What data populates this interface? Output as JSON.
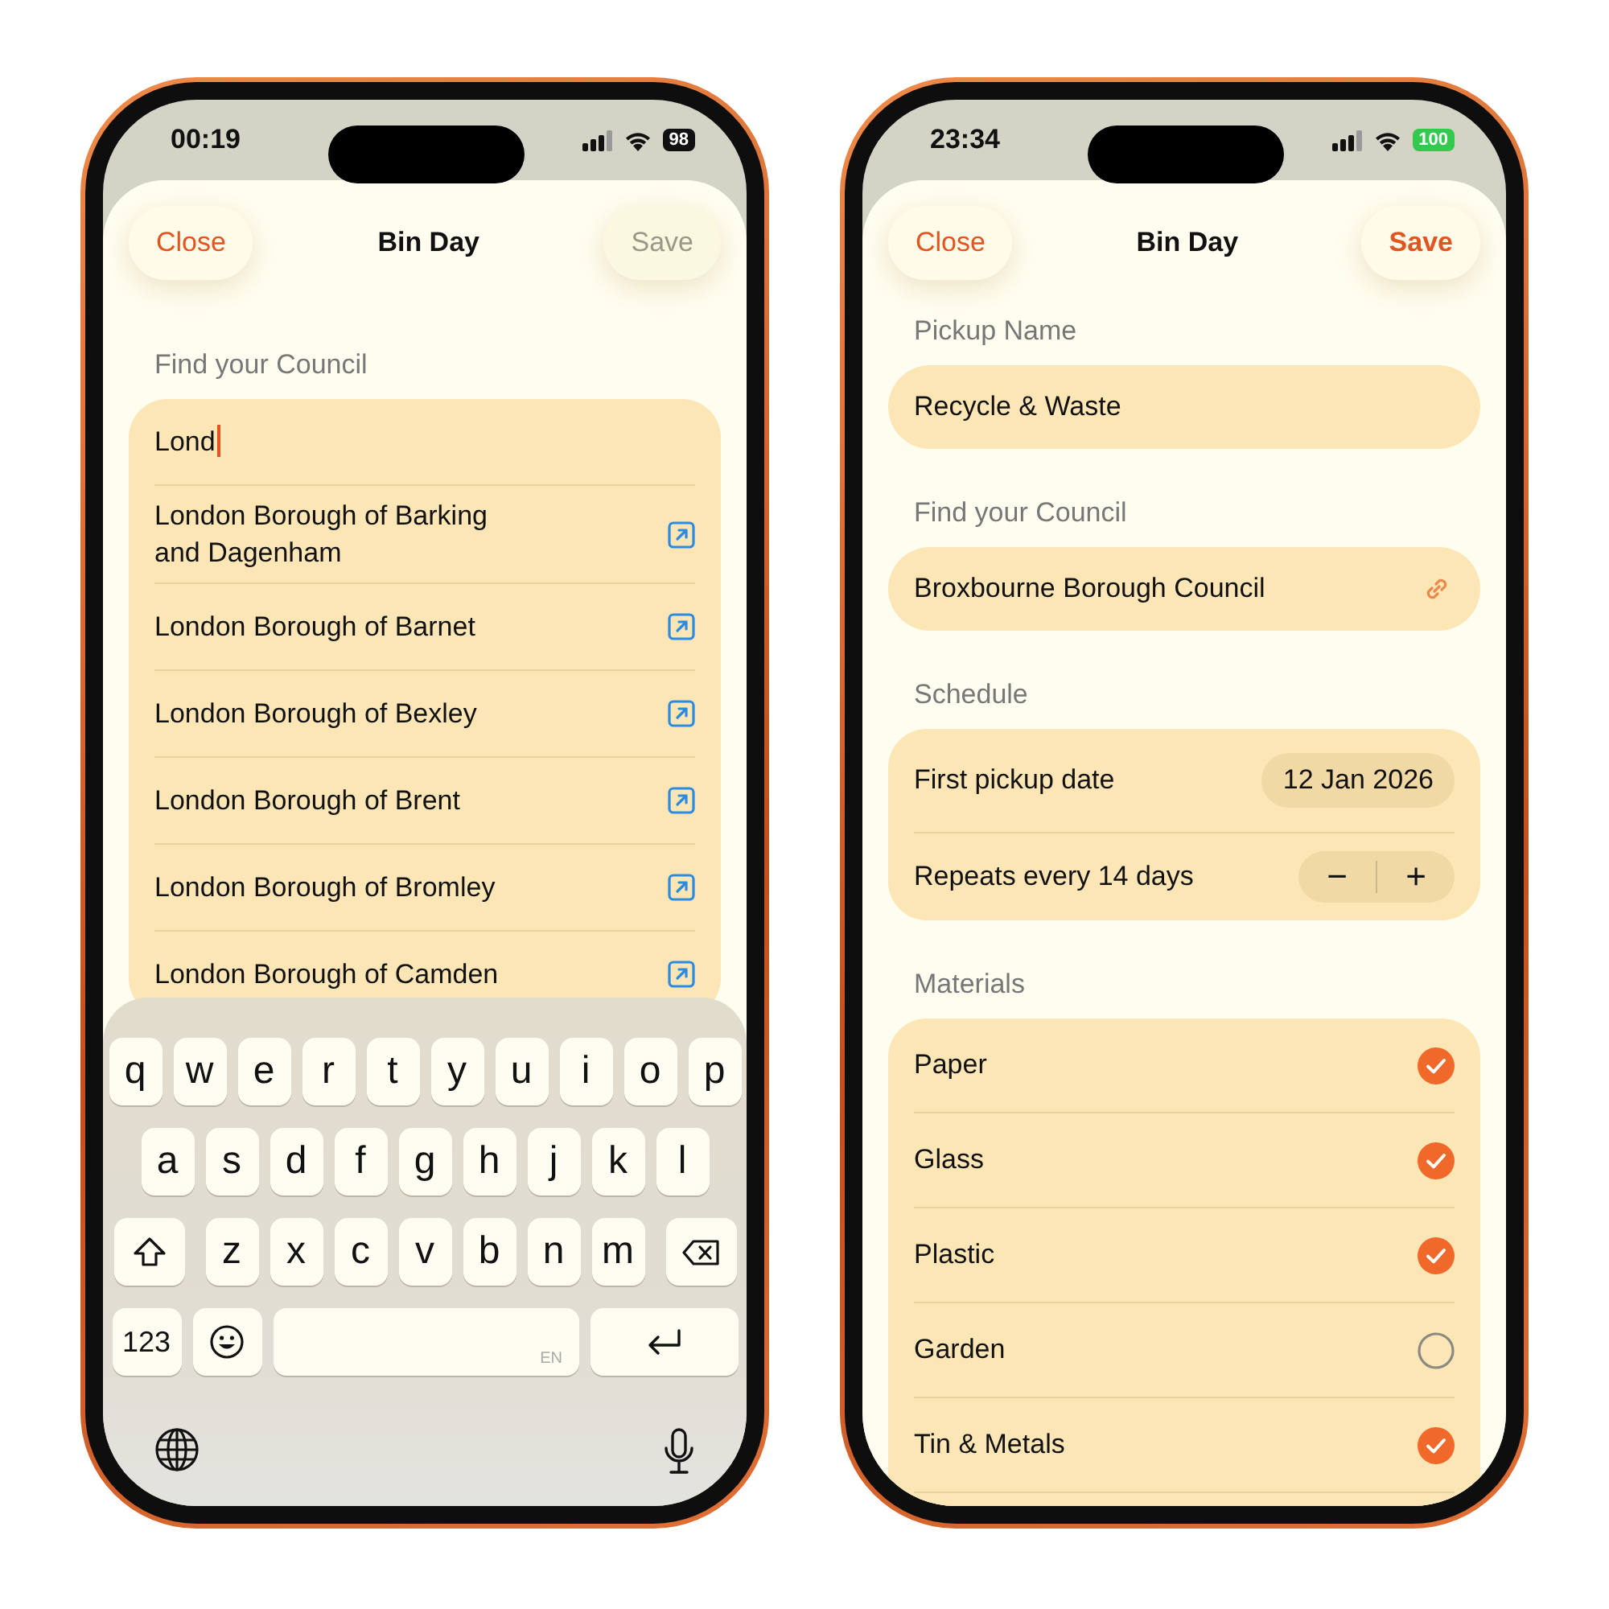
{
  "phones": [
    {
      "status_bar": {
        "time": "00:19",
        "battery": "98",
        "charging": false
      },
      "header": {
        "close": "Close",
        "title": "Bin Day",
        "save": "Save",
        "save_enabled": false
      },
      "sections": [
        {
          "kind": "search",
          "label": "Find your Council",
          "query": "Lond",
          "results": [
            {
              "name": "London Borough of Barking and Dagenham"
            },
            {
              "name": "London Borough of Barnet"
            },
            {
              "name": "London Borough of Bexley"
            },
            {
              "name": "London Borough of Brent"
            },
            {
              "name": "London Borough of Bromley"
            },
            {
              "name": "London Borough of Camden"
            }
          ]
        }
      ],
      "keyboard": {
        "rows": [
          [
            "q",
            "w",
            "e",
            "r",
            "t",
            "y",
            "u",
            "i",
            "o",
            "p"
          ],
          [
            "a",
            "s",
            "d",
            "f",
            "g",
            "h",
            "j",
            "k",
            "l"
          ],
          [
            "z",
            "x",
            "c",
            "v",
            "b",
            "n",
            "m"
          ]
        ],
        "numbers_key": "123",
        "language": "EN"
      }
    },
    {
      "status_bar": {
        "time": "23:34",
        "battery": "100",
        "charging": true
      },
      "header": {
        "close": "Close",
        "title": "Bin Day",
        "save": "Save",
        "save_enabled": true
      },
      "sections": [
        {
          "kind": "text_field",
          "label": "Pickup Name",
          "value": "Recycle & Waste"
        },
        {
          "kind": "link_field",
          "label": "Find your Council",
          "value": "Broxbourne Borough Council"
        },
        {
          "kind": "schedule",
          "label": "Schedule",
          "date_label": "First pickup date",
          "date": "12 Jan 2026",
          "repeat_label": "Repeats every 14 days",
          "decrement": "−",
          "increment": "+"
        },
        {
          "kind": "checklist",
          "label": "Materials",
          "items": [
            {
              "name": "Paper",
              "checked": true
            },
            {
              "name": "Glass",
              "checked": true
            },
            {
              "name": "Plastic",
              "checked": true
            },
            {
              "name": "Garden",
              "checked": false
            },
            {
              "name": "Tin & Metals",
              "checked": true
            }
          ]
        }
      ]
    }
  ]
}
